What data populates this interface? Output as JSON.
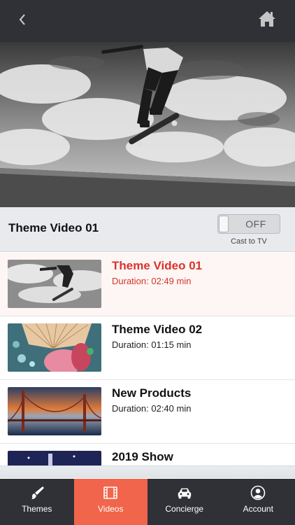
{
  "header": {
    "back_icon": "chevron-left-icon",
    "home_icon": "home-icon"
  },
  "player": {
    "now_playing_title": "Theme Video 01"
  },
  "cast": {
    "state": "OFF",
    "caption": "Cast to TV"
  },
  "videos": [
    {
      "title": "Theme Video 01",
      "duration": "Duration: 02:49 min",
      "active": true
    },
    {
      "title": "Theme Video 02",
      "duration": "Duration: 01:15 min",
      "active": false
    },
    {
      "title": "New Products",
      "duration": "Duration: 02:40 min",
      "active": false
    },
    {
      "title": "2019 Show",
      "duration": "",
      "active": false
    }
  ],
  "tabs": [
    {
      "label": "Themes",
      "icon": "paintbrush-icon",
      "selected": false
    },
    {
      "label": "Videos",
      "icon": "film-icon",
      "selected": true
    },
    {
      "label": "Concierge",
      "icon": "car-icon",
      "selected": false
    },
    {
      "label": "Account",
      "icon": "person-icon",
      "selected": false
    }
  ],
  "colors": {
    "bar": "#2f3136",
    "accent": "#f0654b",
    "active_text": "#d8342b"
  }
}
